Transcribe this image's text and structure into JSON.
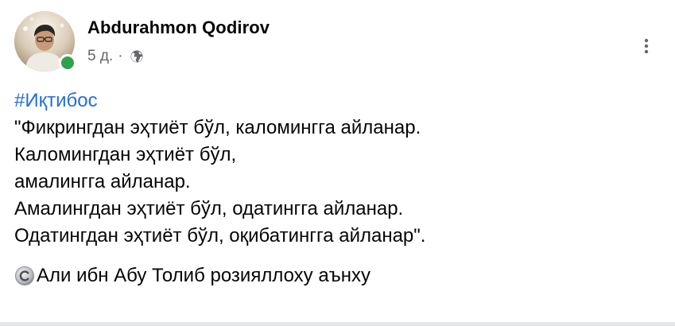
{
  "post": {
    "author_name": "Abdurahmon Qodirov",
    "time": "5 д.",
    "meta_separator": "·",
    "audience_icon": "globe-icon",
    "online": true,
    "colors": {
      "name": "#050505",
      "meta": "#65676b",
      "hashtag": "#216fdb",
      "online": "#31a24c",
      "text": "#050505"
    },
    "hashtag": "#Иқтибос",
    "lines": [
      "\"Фикрингдан эҳтиёт бўл, каломингга айланар.",
      "Каломингдан эҳтиёт бўл,",
      "амалингга айланар.",
      "Амалингдан эҳтиёт бўл, одатингга айланар.",
      "Одатингдан эҳтиёт бўл, оқибатингга айланар\"."
    ],
    "source_icon": "copyright-icon",
    "source": "Али ибн Абу Толиб розияллоху аънху"
  }
}
